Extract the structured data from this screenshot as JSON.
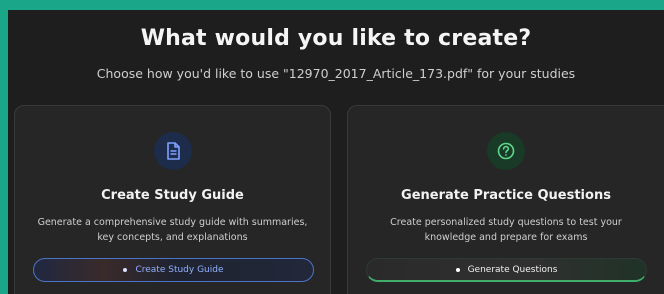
{
  "header": {
    "title": "What would you like to create?",
    "subtitle": "Choose how you'd like to use \"12970_2017_Article_173.pdf\" for your studies"
  },
  "cards": [
    {
      "icon": "document-icon",
      "title": "Create Study Guide",
      "description": "Generate a comprehensive study guide with summaries, key concepts, and explanations",
      "button_label": "Create Study Guide",
      "accent": "#4b74c8"
    },
    {
      "icon": "question-circle-icon",
      "title": "Generate Practice Questions",
      "description": "Create personalized study questions to test your knowledge and prepare for exams",
      "button_label": "Generate Questions",
      "accent": "#3fae6a"
    }
  ]
}
